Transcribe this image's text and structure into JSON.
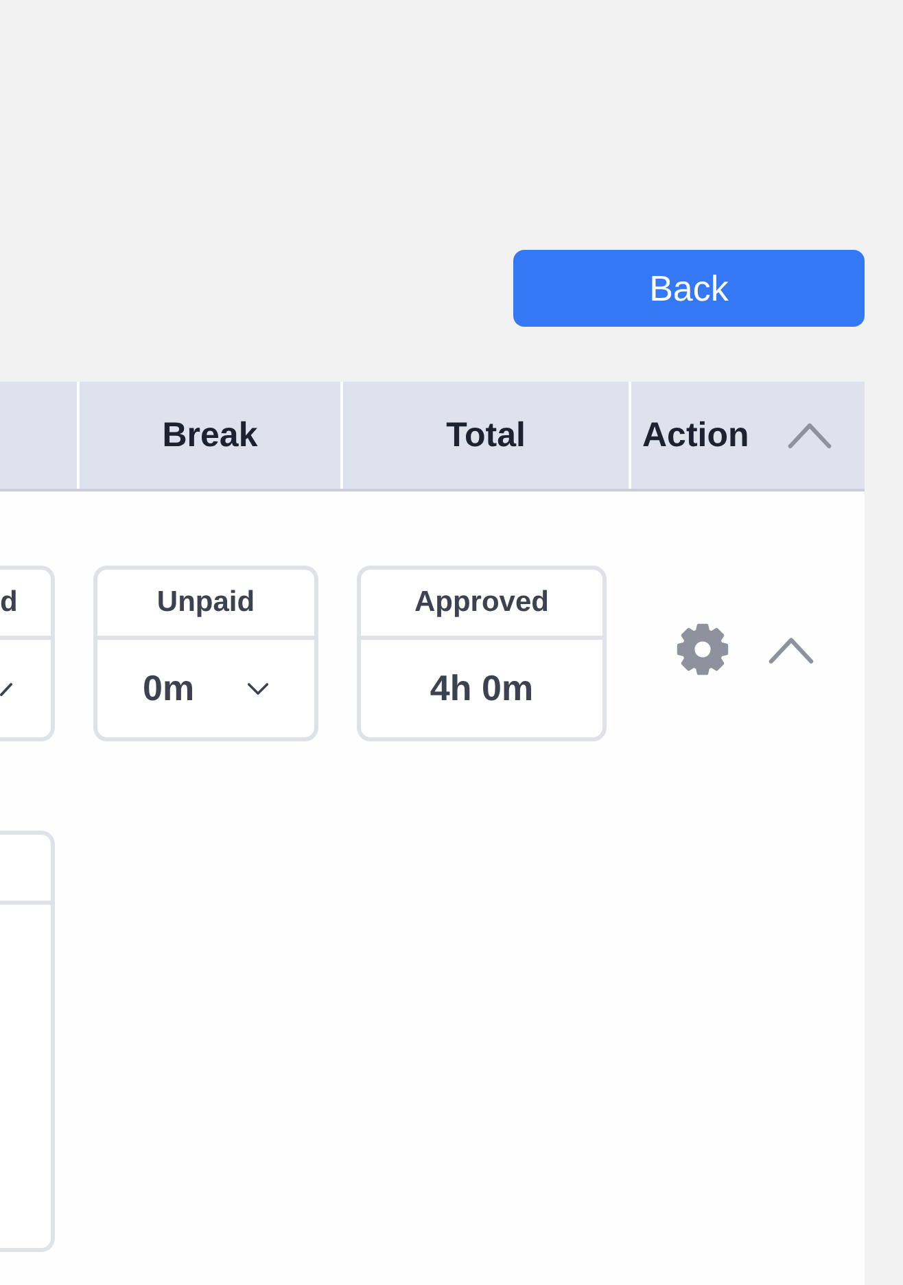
{
  "back_button": {
    "label": "Back"
  },
  "table": {
    "columns": [
      {
        "label": "Break"
      },
      {
        "label": "Total"
      },
      {
        "label": "Action"
      }
    ],
    "all_expanded": true,
    "rows": [
      {
        "expanded": true,
        "fields": [
          {
            "kind": "select",
            "label": "d",
            "cut": true
          },
          {
            "kind": "select",
            "label": "Unpaid",
            "value": "0m",
            "cut": false
          },
          {
            "kind": "readout",
            "label": "Approved",
            "value": "4h 0m",
            "cut": false
          }
        ]
      }
    ]
  }
}
